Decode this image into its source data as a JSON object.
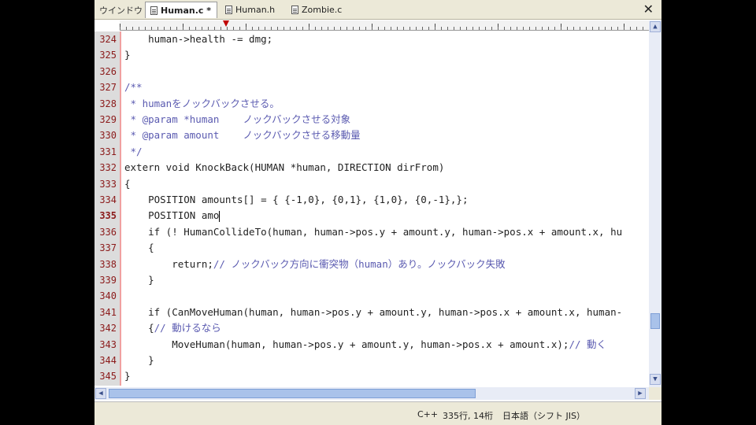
{
  "tabbar": {
    "menu_label": "ウインドウ",
    "tabs": [
      {
        "label": "Human.c *",
        "active": true
      },
      {
        "label": "Human.h",
        "active": false
      },
      {
        "label": "Zombie.c",
        "active": false
      }
    ],
    "close_symbol": "✕"
  },
  "editor": {
    "current_line": "335",
    "lines": [
      {
        "no": "324",
        "text": "    human->health -= dmg;"
      },
      {
        "no": "325",
        "text": "}"
      },
      {
        "no": "326",
        "text": ""
      },
      {
        "no": "327",
        "text": "/**"
      },
      {
        "no": "328",
        "text": " * humanをノックバックさせる。"
      },
      {
        "no": "329",
        "text": " * @param *human    ノックバックさせる対象"
      },
      {
        "no": "330",
        "text": " * @param amount    ノックバックさせる移動量"
      },
      {
        "no": "331",
        "text": " */"
      },
      {
        "no": "332",
        "text": "extern void KnockBack(HUMAN *human, DIRECTION dirFrom)"
      },
      {
        "no": "333",
        "text": "{"
      },
      {
        "no": "334",
        "text": "    POSITION amounts[] = { {-1,0}, {0,1}, {1,0}, {0,-1},};"
      },
      {
        "no": "335",
        "text": "    POSITION amo"
      },
      {
        "no": "336",
        "text": "    if (! HumanCollideTo(human, human->pos.y + amount.y, human->pos.x + amount.x, hu"
      },
      {
        "no": "337",
        "text": "    {"
      },
      {
        "no": "338",
        "text": "        return;",
        "comment": "// ノックバック方向に衝突物（human）あり。ノックバック失敗"
      },
      {
        "no": "339",
        "text": "    }"
      },
      {
        "no": "340",
        "text": ""
      },
      {
        "no": "341",
        "text": "    if (CanMoveHuman(human, human->pos.y + amount.y, human->pos.x + amount.x, human-"
      },
      {
        "no": "342",
        "text": "    {",
        "comment": "// 動けるなら"
      },
      {
        "no": "343",
        "text": "        MoveHuman(human, human->pos.y + amount.y, human->pos.x + amount.x);",
        "comment": "// 動く"
      },
      {
        "no": "344",
        "text": "    }"
      },
      {
        "no": "345",
        "text": "}"
      }
    ]
  },
  "scrollbars": {
    "up": "▲",
    "down": "▼",
    "left": "◀",
    "right": "▶"
  },
  "status": {
    "language": "C++",
    "position": "335行, 14桁",
    "encoding": "日本語（シフト JIS）"
  },
  "colors": {
    "line_number": "#8b1a1a",
    "comment": "#5a5ab0",
    "gutter": "#dcdcdc",
    "scroll_thumb": "#a9c2ea"
  }
}
